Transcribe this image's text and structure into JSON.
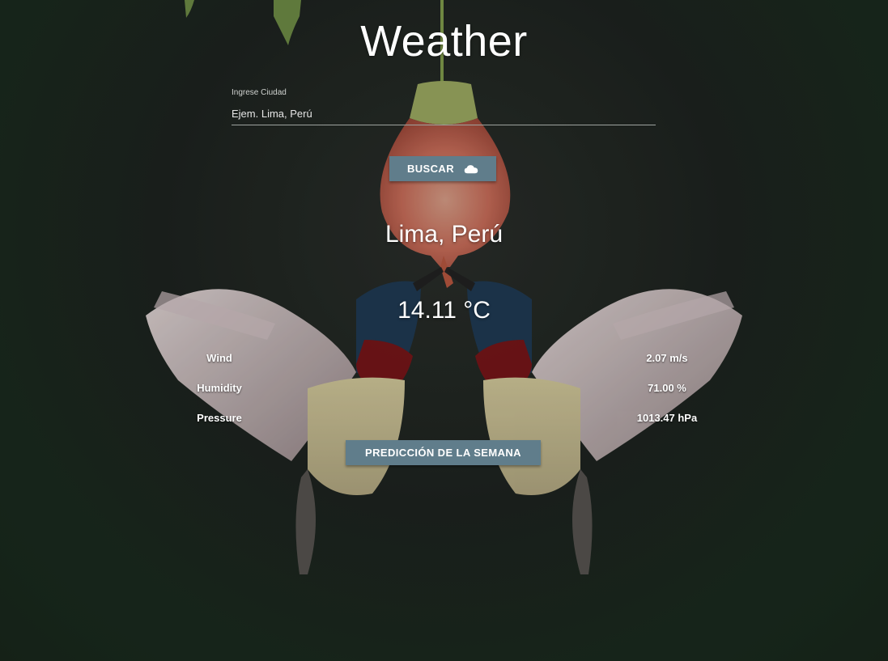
{
  "app": {
    "title": "Weather"
  },
  "search": {
    "label": "Ingrese Ciudad",
    "placeholder": "Ejem. Lima, Perú",
    "value": "",
    "button_label": "BUSCAR",
    "button_icon": "cloud-icon"
  },
  "result": {
    "city": "Lima, Perú",
    "temperature": "14.11 °C",
    "stats": [
      {
        "label": "Wind",
        "value": "2.07 m/s"
      },
      {
        "label": "Humidity",
        "value": "71.00 %"
      },
      {
        "label": "Pressure",
        "value": "1013.47 hPa"
      }
    ]
  },
  "forecast": {
    "button_label": "PREDICCIÓN DE LA SEMANA"
  },
  "colors": {
    "button": "#607d8b",
    "text": "#ffffff",
    "background": "#1d231f"
  }
}
